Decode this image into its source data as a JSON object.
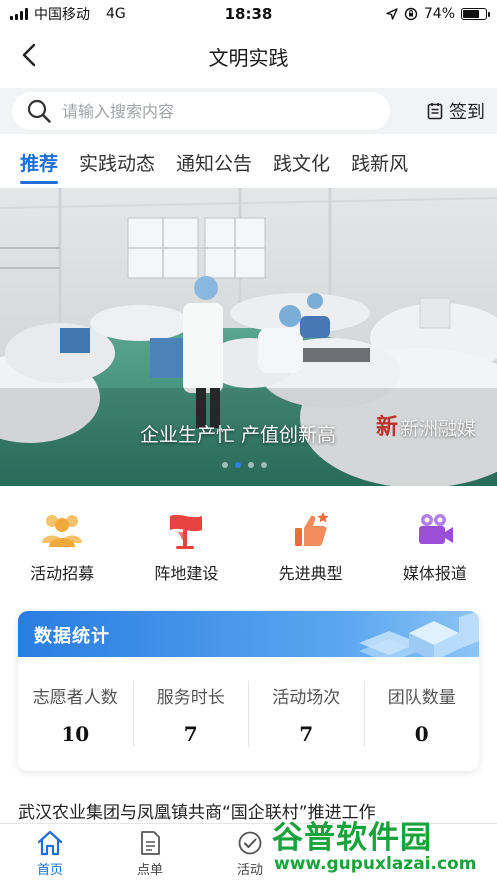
{
  "status_bar": {
    "carrier": "中国移动",
    "network": "4G",
    "time": "18:38",
    "battery": "74%",
    "battery_level": 0.74
  },
  "nav": {
    "title": "文明实践",
    "back_icon": "chevron-left-icon"
  },
  "search": {
    "placeholder": "请输入搜索内容",
    "checkin_label": "签到",
    "checkin_icon": "calendar-icon"
  },
  "tabs": [
    {
      "label": "推荐",
      "active": true
    },
    {
      "label": "实践动态",
      "active": false
    },
    {
      "label": "通知公告",
      "active": false
    },
    {
      "label": "践文化",
      "active": false
    },
    {
      "label": "践新风",
      "active": false
    }
  ],
  "banner": {
    "caption": "企业生产忙 产值创新高",
    "watermark": "新洲融媒",
    "dots_count": 4,
    "active_dot": 1
  },
  "quick_entries": [
    {
      "label": "活动招募",
      "icon": "people-icon",
      "color": "#f2a93b"
    },
    {
      "label": "阵地建设",
      "icon": "flag-icon",
      "color": "#e8433f"
    },
    {
      "label": "先进典型",
      "icon": "thumbs-up-icon",
      "color": "#ef6a3a"
    },
    {
      "label": "媒体报道",
      "icon": "video-camera-icon",
      "color": "#9b4fd6"
    }
  ],
  "stats": {
    "title": "数据统计",
    "items": [
      {
        "label": "志愿者人数",
        "value": "10"
      },
      {
        "label": "服务时长",
        "value": "7"
      },
      {
        "label": "活动场次",
        "value": "7"
      },
      {
        "label": "团队数量",
        "value": "0"
      }
    ]
  },
  "news": {
    "headline": "武汉农业集团与凤凰镇共商“国企联村”推进工作"
  },
  "tabbar": [
    {
      "label": "首页",
      "icon": "home-icon",
      "active": true
    },
    {
      "label": "点单",
      "icon": "document-icon",
      "active": false
    },
    {
      "label": "活动",
      "icon": "check-circle-icon",
      "active": false
    }
  ],
  "site_watermark": {
    "title": "谷普软件园",
    "url": "www.gupuxlazai.com"
  },
  "colors": {
    "accent": "#1f6fd8",
    "stats_header": "#2a7de2"
  }
}
